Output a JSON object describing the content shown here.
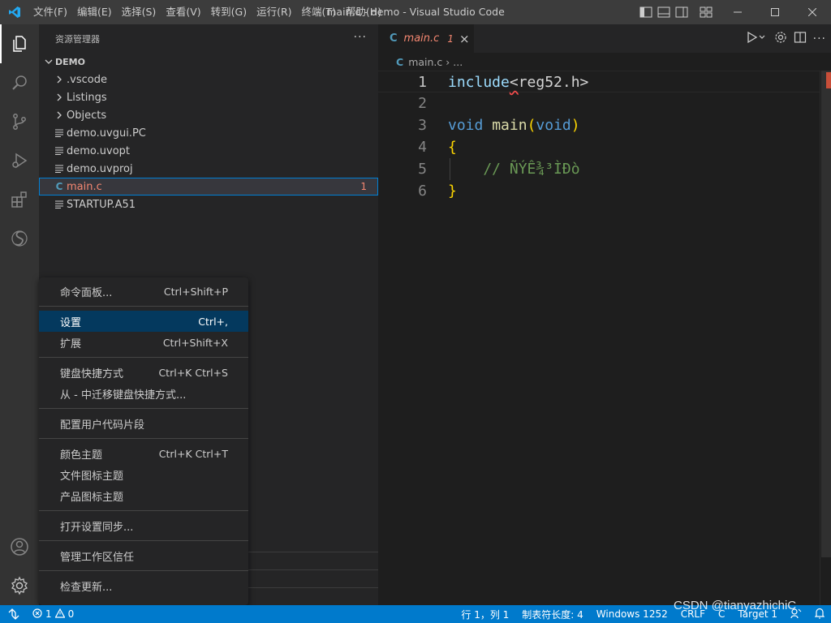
{
  "titlebar": {
    "menu": [
      "文件(F)",
      "编辑(E)",
      "选择(S)",
      "查看(V)",
      "转到(G)",
      "运行(R)",
      "终端(T)",
      "帮助(H)"
    ],
    "title": "main.c - demo - Visual Studio Code"
  },
  "sidebar": {
    "header": "资源管理器",
    "more": "···",
    "section": "DEMO",
    "items": [
      {
        "label": ".vscode",
        "type": "folder"
      },
      {
        "label": "Listings",
        "type": "folder"
      },
      {
        "label": "Objects",
        "type": "folder"
      },
      {
        "label": "demo.uvgui.PC",
        "type": "file"
      },
      {
        "label": "demo.uvopt",
        "type": "file"
      },
      {
        "label": "demo.uvproj",
        "type": "file"
      },
      {
        "label": "main.c",
        "type": "c-file",
        "badge": "1"
      },
      {
        "label": "STARTUP.A51",
        "type": "file"
      }
    ]
  },
  "editor": {
    "tab": {
      "icon": "C",
      "name": "main.c",
      "problems": "1",
      "close": "×"
    },
    "breadcrumb": {
      "icon": "C",
      "file": "main.c",
      "sep": "›",
      "more": "..."
    },
    "line_numbers": [
      "1",
      "2",
      "3",
      "4",
      "5",
      "6"
    ],
    "code": {
      "l1_a": "include",
      "l1_b": "<",
      "l1_c": "reg52.h>",
      "l3_kw1": "void",
      "l3_fn": "main",
      "l3_open": "(",
      "l3_kw2": "void",
      "l3_close": ")",
      "l4": "{",
      "l5": "    // ÑÝÊ¾³ÌÐò",
      "l6": "}"
    }
  },
  "context_menu": {
    "items": [
      {
        "label": "命令面板...",
        "shortcut": "Ctrl+Shift+P"
      },
      {
        "label": "设置",
        "shortcut": "Ctrl+,"
      },
      {
        "label": "扩展",
        "shortcut": "Ctrl+Shift+X"
      },
      {
        "label": "键盘快捷方式",
        "shortcut": "Ctrl+K Ctrl+S"
      },
      {
        "label": "从 - 中迁移键盘快捷方式...",
        "shortcut": ""
      },
      {
        "label": "配置用户代码片段",
        "shortcut": ""
      },
      {
        "label": "颜色主题",
        "shortcut": "Ctrl+K Ctrl+T"
      },
      {
        "label": "文件图标主题",
        "shortcut": ""
      },
      {
        "label": "产品图标主题",
        "shortcut": ""
      },
      {
        "label": "打开设置同步...",
        "shortcut": ""
      },
      {
        "label": "管理工作区信任",
        "shortcut": ""
      },
      {
        "label": "检查更新...",
        "shortcut": ""
      }
    ]
  },
  "statusbar": {
    "errors": "1",
    "warnings": "0",
    "position": "行 1，列 1",
    "tab_size": "制表符长度: 4",
    "encoding": "Windows 1252",
    "eol": "CRLF",
    "language": "C",
    "target": "Target 1"
  },
  "watermark": "CSDN @tianyazhichiC",
  "colors": {
    "accent": "#007acc",
    "error": "#f48771",
    "menu_highlight": "#04395e"
  }
}
